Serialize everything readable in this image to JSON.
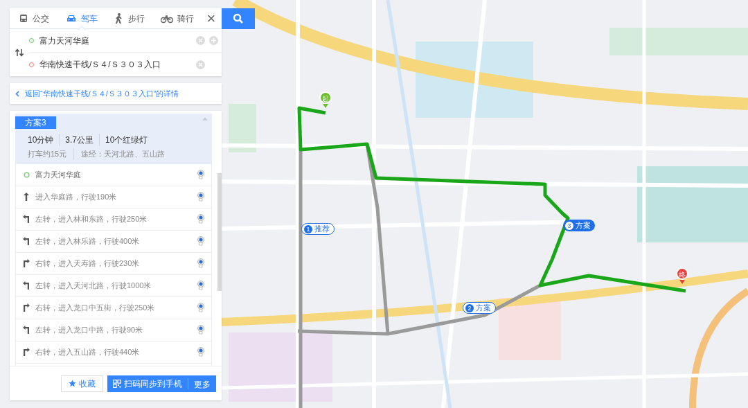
{
  "tabs": [
    {
      "kind": "bus",
      "label": "公交",
      "selected": false
    },
    {
      "kind": "car",
      "label": "驾车",
      "selected": true
    },
    {
      "kind": "walk",
      "label": "步行",
      "selected": false
    },
    {
      "kind": "bike",
      "label": "骑行",
      "selected": false
    }
  ],
  "close": "×",
  "route_inputs": [
    {
      "kind": "origin",
      "value": "富力天河华庭",
      "can_add": true
    },
    {
      "kind": "destination",
      "value": "华南快速干线/Ｓ４/Ｓ３０３入口",
      "can_add": false
    }
  ],
  "back_link": "返回“华南快速干线/Ｓ４/Ｓ３０３入口”的详情",
  "plan": {
    "title": "方案3",
    "expanded": true,
    "stats": [
      "10分钟",
      "3.7公里",
      "10个红绿灯"
    ],
    "details": [
      "打车约15元",
      "途经：天河北路、五山路"
    ],
    "steps": [
      {
        "kind": "origin",
        "text": "富力天河华庭"
      },
      {
        "kind": "straight",
        "text": "进入华庭路，行驶190米"
      },
      {
        "kind": "left",
        "text": "左转，进入林和东路，行驶250米"
      },
      {
        "kind": "left",
        "text": "左转，进入林乐路，行驶400米"
      },
      {
        "kind": "right",
        "text": "右转，进入天寿路，行驶230米"
      },
      {
        "kind": "left",
        "text": "左转，进入天河北路，行驶1000米"
      },
      {
        "kind": "right",
        "text": "右转，进入龙口中五街，行驶250米"
      },
      {
        "kind": "left",
        "text": "左转，进入龙口中路，行驶90米"
      },
      {
        "kind": "right",
        "text": "右转，进入五山路，行驶440米"
      }
    ]
  },
  "footer": {
    "favorite": "收藏",
    "sync": "扫码同步到手机",
    "more": "更多"
  },
  "map": {
    "start_pin": "起",
    "end_pin": "终",
    "route_labels": [
      {
        "number": "1",
        "label": "推荐",
        "selected": false
      },
      {
        "number": "2",
        "label": "方案",
        "selected": false
      },
      {
        "number": "3",
        "label": "方案",
        "selected": true
      }
    ]
  }
}
